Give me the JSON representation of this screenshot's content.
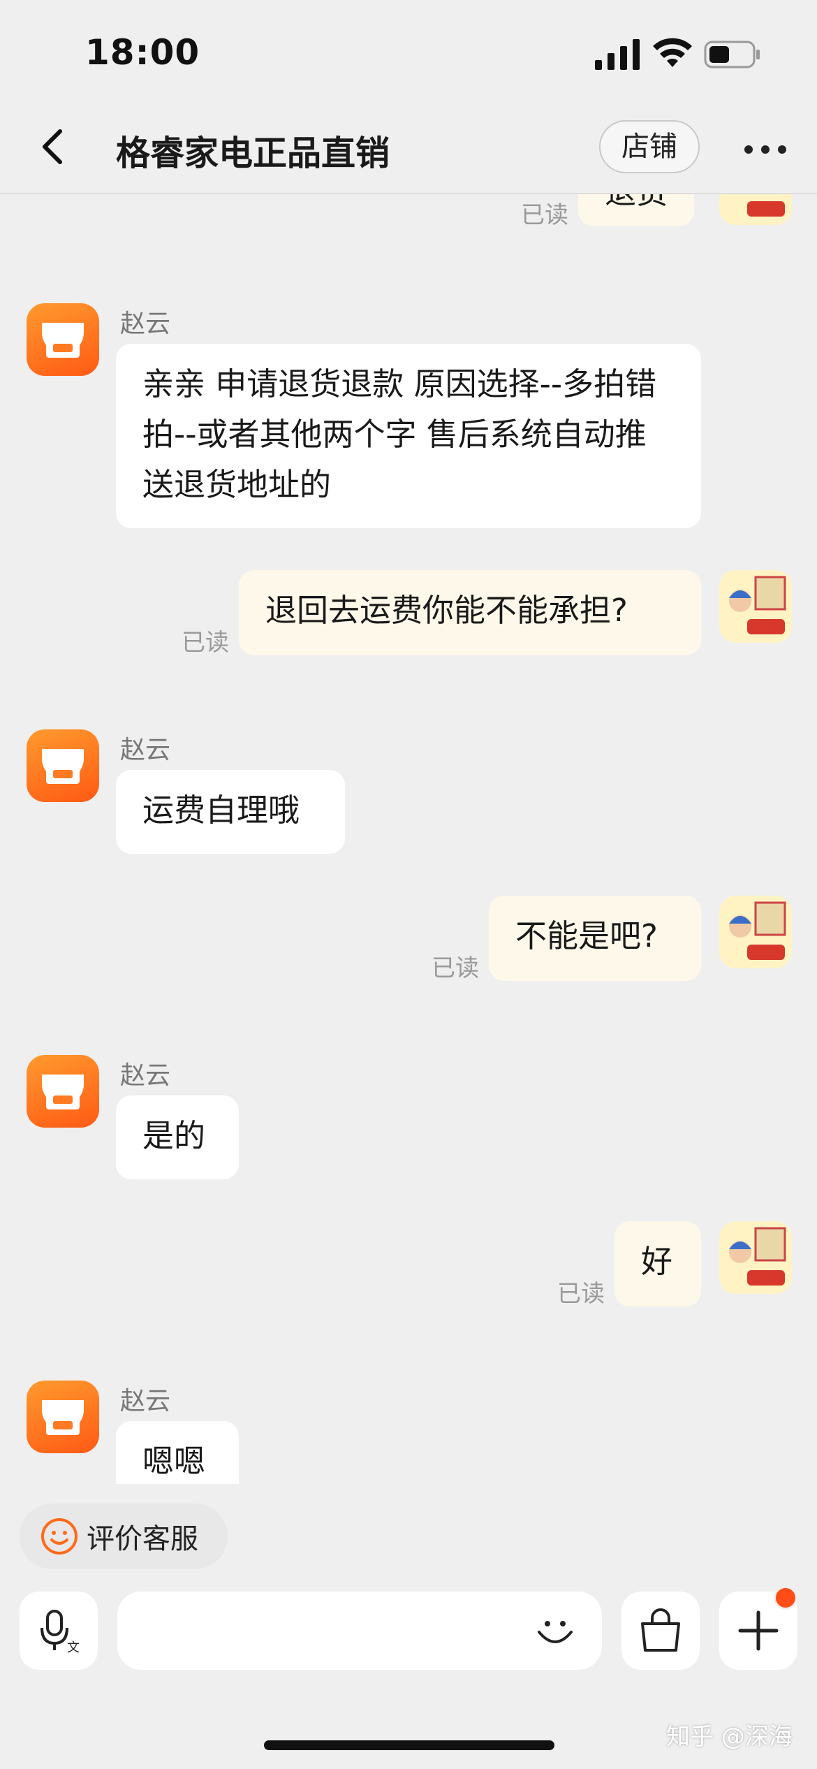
{
  "status_bar": {
    "time": "18:00"
  },
  "header": {
    "title": "格睿家电正品直销",
    "store_label": "店铺"
  },
  "chat": {
    "top_partial": {
      "text": "退货",
      "read": "已读"
    },
    "messages": [
      {
        "sender": "赵云",
        "text": "亲亲 申请退货退款 原因选择--多拍错拍--或者其他两个字   售后系统自动推送退货地址的"
      },
      {
        "text": "退回去运费你能不能承担?",
        "read": "已读"
      },
      {
        "sender": "赵云",
        "text": "运费自理哦"
      },
      {
        "text": "不能是吧?",
        "read": "已读"
      },
      {
        "sender": "赵云",
        "text": "是的"
      },
      {
        "text": "好",
        "read": "已读"
      },
      {
        "sender": "赵云",
        "text": "嗯嗯"
      }
    ]
  },
  "rate_service": {
    "label": "评价客服"
  },
  "input": {
    "placeholder": ""
  },
  "watermark": "知乎 @深海",
  "colors": {
    "accent": "#ff5a14",
    "bubble_out": "#fef8ea",
    "bubble_in": "#ffffff",
    "background": "#efefef"
  },
  "icons": [
    "back-arrow-icon",
    "more-icon",
    "shop-icon",
    "smile-icon",
    "voice-input-icon",
    "emoji-icon",
    "shopping-bag-icon",
    "plus-icon"
  ]
}
